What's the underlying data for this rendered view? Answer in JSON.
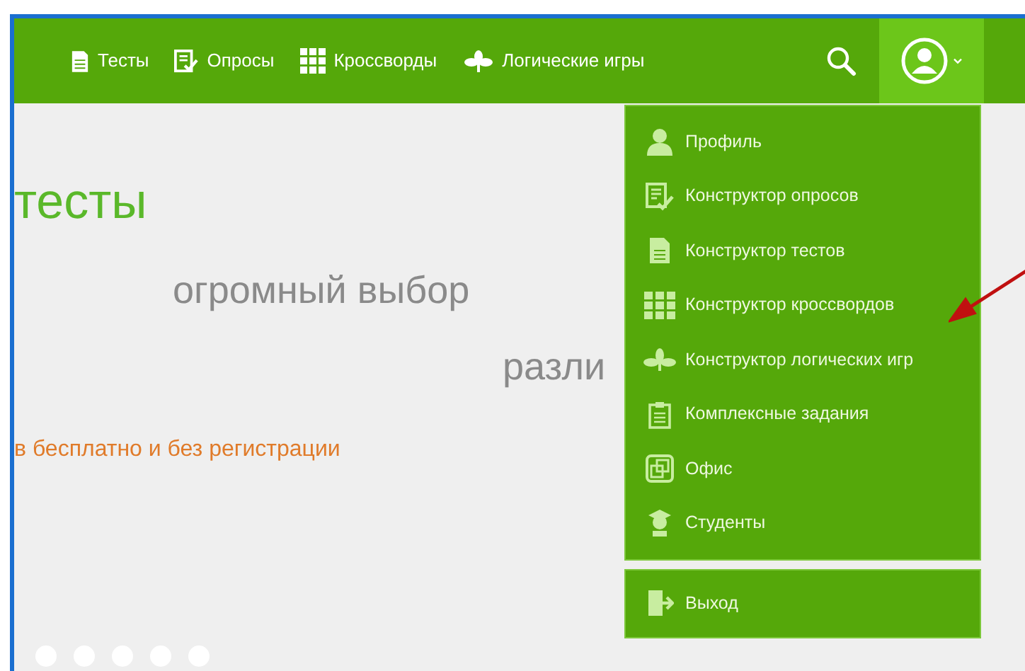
{
  "nav": {
    "items": [
      {
        "label": "Тесты"
      },
      {
        "label": "Опросы"
      },
      {
        "label": "Кроссворды"
      },
      {
        "label": "Логические игры"
      }
    ]
  },
  "user_menu": {
    "expanded": true,
    "items": [
      {
        "label": "Профиль"
      },
      {
        "label": "Конструктор опросов"
      },
      {
        "label": "Конструктор тестов"
      },
      {
        "label": "Конструктор кроссвордов"
      },
      {
        "label": "Конструктор логических игр"
      },
      {
        "label": "Комплексные задания"
      },
      {
        "label": "Офис"
      },
      {
        "label": "Студенты"
      }
    ],
    "logout": {
      "label": "Выход"
    }
  },
  "hero": {
    "title": "тесты",
    "subtitle": "огромный выбор",
    "line_3": "разли",
    "tagline": "в бесплатно и без регистрации"
  }
}
